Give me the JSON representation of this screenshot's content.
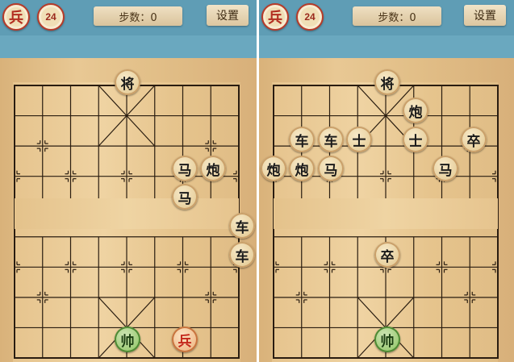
{
  "left": {
    "header": {
      "piece_badge": "兵",
      "level": "24",
      "steps": "步数：0",
      "settings_label": "设置"
    },
    "pieces": [
      {
        "char": "将",
        "color": "black"
      },
      {
        "char": "马",
        "color": "black"
      },
      {
        "char": "炮",
        "color": "black"
      },
      {
        "char": "马",
        "color": "black"
      },
      {
        "char": "车",
        "color": "black"
      },
      {
        "char": "车",
        "color": "black"
      },
      {
        "char": "帅",
        "color": "green"
      },
      {
        "char": "兵",
        "color": "red"
      }
    ]
  },
  "right": {
    "header": {
      "piece_badge": "兵",
      "level": "24",
      "steps": "步数：0",
      "settings_label": "设置"
    },
    "pieces": [
      {
        "char": "将",
        "color": "black"
      },
      {
        "char": "炮",
        "color": "black"
      },
      {
        "char": "车",
        "color": "black"
      },
      {
        "char": "车",
        "color": "black"
      },
      {
        "char": "士",
        "color": "black"
      },
      {
        "char": "士",
        "color": "black"
      },
      {
        "char": "卒",
        "color": "black"
      },
      {
        "char": "炮",
        "color": "black"
      },
      {
        "char": "炮",
        "color": "black"
      },
      {
        "char": "马",
        "color": "black"
      },
      {
        "char": "马",
        "color": "black"
      },
      {
        "char": "卒",
        "color": "black"
      },
      {
        "char": "帅",
        "color": "green"
      }
    ]
  },
  "colors": {
    "red_text": "#c4281c",
    "green_piece": "#9ccb74",
    "header_blue": "#5f9db5"
  }
}
